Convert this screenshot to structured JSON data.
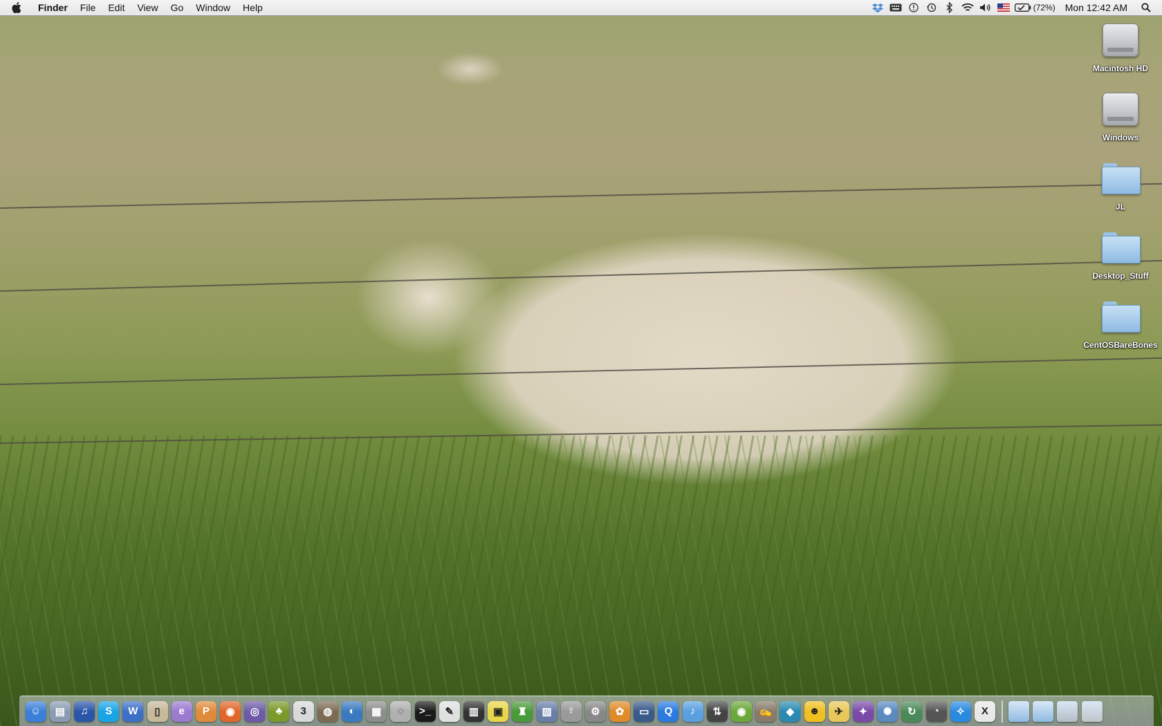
{
  "menubar": {
    "apple_icon": "apple-icon",
    "app_name": "Finder",
    "menus": [
      "File",
      "Edit",
      "View",
      "Go",
      "Window",
      "Help"
    ],
    "status_icons": [
      "dropbox-icon",
      "keyboard-icon",
      "alert-icon",
      "time-machine-icon",
      "bluetooth-icon",
      "wifi-icon",
      "volume-icon",
      "us-flag-input-icon",
      "battery-icon"
    ],
    "battery_text": "(72%)",
    "clock": "Mon 12:42 AM",
    "spotlight_icon": "spotlight-search-icon"
  },
  "desktop": {
    "icons": [
      {
        "label": "Macintosh HD",
        "kind": "hard-drive"
      },
      {
        "label": "Windows",
        "kind": "hard-drive"
      },
      {
        "label": "JL",
        "kind": "folder"
      },
      {
        "label": "Desktop_Stuff",
        "kind": "folder"
      },
      {
        "label": "CentOSBareBones",
        "kind": "folder"
      }
    ]
  },
  "dock": {
    "apps": [
      {
        "name": "finder",
        "glyph": "☺",
        "color": "#3b7fd8"
      },
      {
        "name": "preview",
        "glyph": "▤",
        "color": "#8a9bb3"
      },
      {
        "name": "audio-app",
        "glyph": "♫",
        "color": "#2a55a8"
      },
      {
        "name": "skype",
        "glyph": "S",
        "color": "#19a4e6"
      },
      {
        "name": "word",
        "glyph": "W",
        "color": "#3d6fc8"
      },
      {
        "name": "notebook",
        "glyph": "▯",
        "color": "#c8b99a"
      },
      {
        "name": "editor",
        "glyph": "e",
        "color": "#9a7bd0"
      },
      {
        "name": "pages",
        "glyph": "P",
        "color": "#e08a3c"
      },
      {
        "name": "firefox",
        "glyph": "◉",
        "color": "#e0662a"
      },
      {
        "name": "system-app",
        "glyph": "◎",
        "color": "#6e5aa8"
      },
      {
        "name": "pineapple-app",
        "glyph": "♣",
        "color": "#7a9a2a"
      },
      {
        "name": "ical",
        "glyph": "3",
        "color": "#d9d9d9"
      },
      {
        "name": "disk-app",
        "glyph": "◍",
        "color": "#7d6a55"
      },
      {
        "name": "network-app",
        "glyph": "◐",
        "color": "#3a7ac0"
      },
      {
        "name": "calculator",
        "glyph": "▦",
        "color": "#8d8d8d"
      },
      {
        "name": "disk-utility",
        "glyph": "◌",
        "color": "#b0b0b0"
      },
      {
        "name": "terminal",
        "glyph": ">_",
        "color": "#1a1a1a"
      },
      {
        "name": "textedit",
        "glyph": "✎",
        "color": "#e0e0e0"
      },
      {
        "name": "film-app",
        "glyph": "▥",
        "color": "#333333"
      },
      {
        "name": "stickies",
        "glyph": "▣",
        "color": "#e8d64a"
      },
      {
        "name": "automator",
        "glyph": "♜",
        "color": "#4a9a3a"
      },
      {
        "name": "packages",
        "glyph": "▨",
        "color": "#6a7fa8"
      },
      {
        "name": "vlc-app",
        "glyph": "☿",
        "color": "#9a9a9a"
      },
      {
        "name": "settings-app",
        "glyph": "⚙",
        "color": "#888888"
      },
      {
        "name": "flower-app",
        "glyph": "✿",
        "color": "#e08a2a"
      },
      {
        "name": "remote-desktop",
        "glyph": "▭",
        "color": "#3a5a8a"
      },
      {
        "name": "quicktime",
        "glyph": "Q",
        "color": "#2a7ae0"
      },
      {
        "name": "itunes",
        "glyph": "♪",
        "color": "#5aa0e0"
      },
      {
        "name": "transmit",
        "glyph": "⇅",
        "color": "#444444"
      },
      {
        "name": "green-app",
        "glyph": "◉",
        "color": "#6aa83a"
      },
      {
        "name": "gimp",
        "glyph": "✍",
        "color": "#8a7a6a"
      },
      {
        "name": "shield-app",
        "glyph": "◆",
        "color": "#2a8ab0"
      },
      {
        "name": "adium",
        "glyph": "☻",
        "color": "#f0c020"
      },
      {
        "name": "bird-app",
        "glyph": "✈",
        "color": "#e8c85a"
      },
      {
        "name": "star-app",
        "glyph": "✦",
        "color": "#7a4aa8"
      },
      {
        "name": "network-tool",
        "glyph": "✺",
        "color": "#5a8ac0"
      },
      {
        "name": "time-machine",
        "glyph": "↻",
        "color": "#4a8a5a"
      },
      {
        "name": "clock-app",
        "glyph": "◔",
        "color": "#555555"
      },
      {
        "name": "safari",
        "glyph": "✧",
        "color": "#2a8ae0"
      },
      {
        "name": "x11",
        "glyph": "X",
        "color": "#e8e8e8"
      }
    ],
    "stacks": [
      {
        "name": "applications-stack",
        "color": "#8fbbe2"
      },
      {
        "name": "documents-stack",
        "color": "#8fbbe2"
      },
      {
        "name": "downloads-stack",
        "color": "#b5bcc6"
      },
      {
        "name": "trash",
        "color": "#c0c4c8"
      }
    ]
  }
}
